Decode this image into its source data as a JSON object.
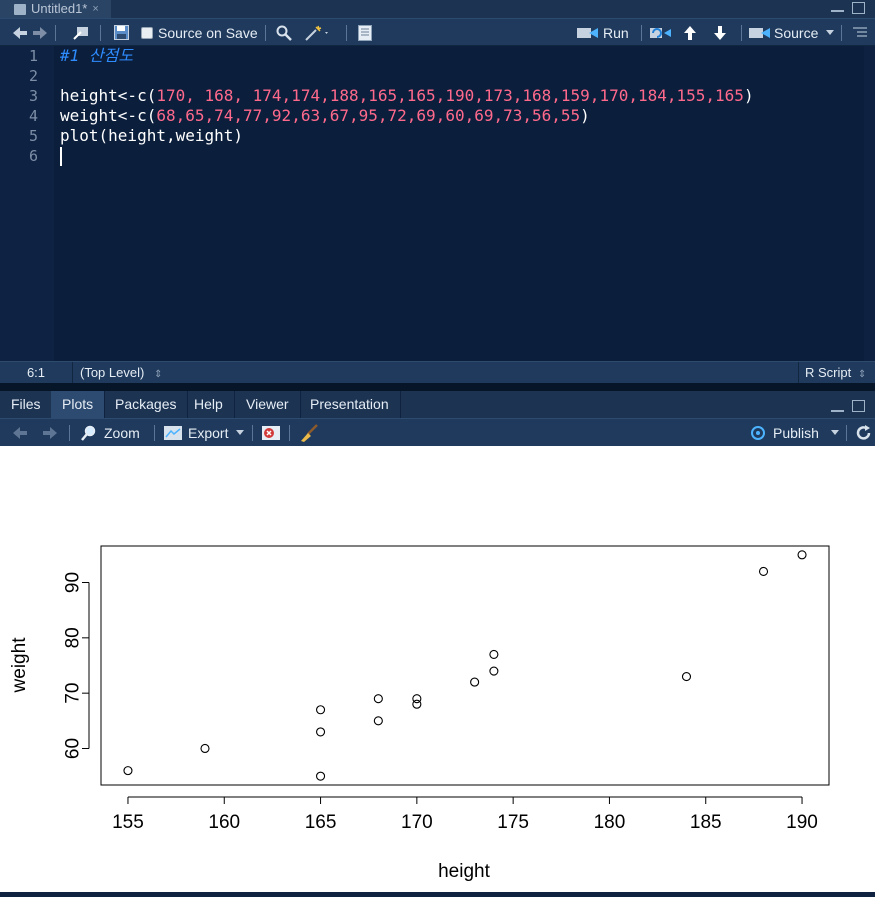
{
  "editor_tab": {
    "title": "Untitled1*",
    "close": "×"
  },
  "editor_toolbar": {
    "source_on_save_label": "Source on Save",
    "run_label": "Run",
    "source_label": "Source"
  },
  "editor": {
    "line_numbers": [
      "1",
      "2",
      "3",
      "4",
      "5",
      "6"
    ],
    "line1_comment": "#1 산점도",
    "line3_prefix": "height<-c(",
    "line3_values": "170, 168, 174,174,188,165,165,190,173,168,159,170,184,155,165",
    "line4_prefix": "weight<-c(",
    "line4_values": "68,65,74,77,92,63,67,95,72,69,60,69,73,56,55",
    "close_paren": ")",
    "line5": "plot(height,weight)"
  },
  "status_bar": {
    "position": "6:1",
    "scope": "(Top Level)",
    "file_type": "R Script"
  },
  "pane_tabs": [
    "Files",
    "Plots",
    "Packages",
    "Help",
    "Viewer",
    "Presentation"
  ],
  "active_pane_tab": "Plots",
  "plots_toolbar": {
    "zoom_label": "Zoom",
    "export_label": "Export",
    "publish_label": "Publish"
  },
  "colors": {
    "editor_bg": "#0b1e3c",
    "number": "#ff6a8c",
    "comment": "#2e8cff",
    "run_icon": "#4db3ff"
  },
  "chart_data": {
    "type": "scatter",
    "x": [
      170,
      168,
      174,
      174,
      188,
      165,
      165,
      190,
      173,
      168,
      159,
      170,
      184,
      155,
      165
    ],
    "y": [
      68,
      65,
      74,
      77,
      92,
      63,
      67,
      95,
      72,
      69,
      60,
      69,
      73,
      56,
      55
    ],
    "xlabel": "height",
    "ylabel": "weight",
    "xlim": [
      153.6,
      191.4
    ],
    "ylim": [
      53.4,
      96.6
    ],
    "xticks": [
      155,
      160,
      165,
      170,
      175,
      180,
      185,
      190
    ],
    "yticks": [
      60,
      70,
      80,
      90
    ],
    "grid": false
  }
}
